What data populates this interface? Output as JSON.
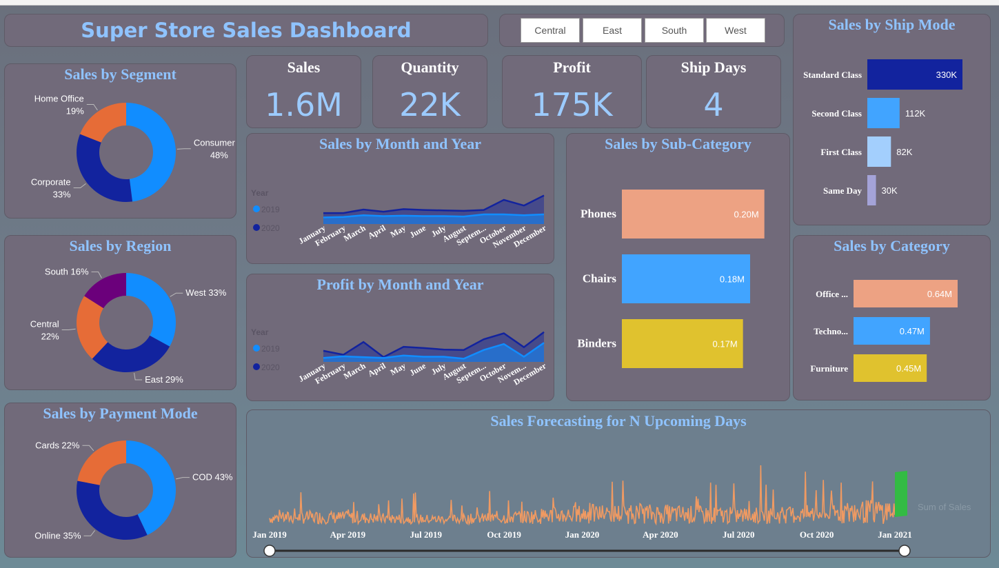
{
  "dashboard": {
    "title": "Super Store Sales Dashboard",
    "region_filters": [
      "Central",
      "East",
      "South",
      "West"
    ],
    "kpis": [
      {
        "label": "Sales",
        "value": "1.6M"
      },
      {
        "label": "Quantity",
        "value": "22K"
      },
      {
        "label": "Profit",
        "value": "175K"
      },
      {
        "label": "Ship Days",
        "value": "4"
      }
    ]
  },
  "colors": {
    "light_blue": "#118dff",
    "dark_blue": "#12239e",
    "orange": "#e66c37",
    "purple": "#6b007b",
    "salmon": "#eda283",
    "sky": "#41a4ff",
    "gold": "#e0c22e",
    "lavender": "#a4a3d8",
    "pale_blue": "#a3cffd",
    "forecast_line": "#f09a62",
    "forecast_band": "#33bb44"
  },
  "chart_data": [
    {
      "id": "segment",
      "type": "pie",
      "title": "Sales by Segment",
      "slices": [
        {
          "name": "Consumer",
          "value": 48,
          "label_line1": "Consumer",
          "label_line2": "48%",
          "color": "#118dff"
        },
        {
          "name": "Corporate",
          "value": 33,
          "label_line1": "Corporate",
          "label_line2": "33%",
          "color": "#12239e"
        },
        {
          "name": "Home Office",
          "value": 19,
          "label_line1": "Home Office",
          "label_line2": "19%",
          "color": "#e66c37"
        }
      ]
    },
    {
      "id": "region",
      "type": "pie",
      "title": "Sales by Region",
      "slices": [
        {
          "name": "West",
          "value": 33,
          "label_line1": "West 33%",
          "label_line2": "",
          "color": "#118dff"
        },
        {
          "name": "East",
          "value": 29,
          "label_line1": "East 29%",
          "label_line2": "",
          "color": "#12239e"
        },
        {
          "name": "Central",
          "value": 22,
          "label_line1": "Central",
          "label_line2": "22%",
          "color": "#e66c37"
        },
        {
          "name": "South",
          "value": 16,
          "label_line1": "South 16%",
          "label_line2": "",
          "color": "#6b007b"
        }
      ]
    },
    {
      "id": "payment",
      "type": "pie",
      "title": "Sales by Payment Mode",
      "slices": [
        {
          "name": "COD",
          "value": 43,
          "label_line1": "COD 43%",
          "label_line2": "",
          "color": "#118dff"
        },
        {
          "name": "Online",
          "value": 35,
          "label_line1": "Online 35%",
          "label_line2": "",
          "color": "#12239e"
        },
        {
          "name": "Cards",
          "value": 22,
          "label_line1": "Cards 22%",
          "label_line2": "",
          "color": "#e66c37"
        }
      ]
    },
    {
      "id": "sales_month",
      "type": "area",
      "title": "Sales by Month and Year",
      "legend_title": "Year",
      "categories": [
        "January",
        "February",
        "March",
        "April",
        "May",
        "June",
        "July",
        "August",
        "Septem...",
        "October",
        "November",
        "December"
      ],
      "series": [
        {
          "name": "2019",
          "values": [
            0.15,
            0.16,
            0.2,
            0.18,
            0.19,
            0.18,
            0.18,
            0.17,
            0.22,
            0.22,
            0.2,
            0.22
          ],
          "color": "#118dff"
        },
        {
          "name": "2020",
          "values": [
            0.25,
            0.25,
            0.33,
            0.28,
            0.34,
            0.32,
            0.31,
            0.3,
            0.32,
            0.55,
            0.42,
            0.65
          ],
          "color": "#12239e"
        }
      ],
      "ylim": [
        0,
        0.8
      ]
    },
    {
      "id": "profit_month",
      "type": "area",
      "title": "Profit by Month and Year",
      "legend_title": "Year",
      "categories": [
        "January",
        "February",
        "March",
        "April",
        "May",
        "June",
        "July",
        "August",
        "Septem...",
        "October",
        "Novem...",
        "December"
      ],
      "series": [
        {
          "name": "2019",
          "values": [
            0.1,
            0.14,
            0.12,
            0.1,
            0.16,
            0.13,
            0.13,
            0.08,
            0.3,
            0.45,
            0.13,
            0.48
          ],
          "color": "#118dff"
        },
        {
          "name": "2020",
          "values": [
            0.28,
            0.18,
            0.5,
            0.12,
            0.38,
            0.35,
            0.31,
            0.3,
            0.57,
            0.72,
            0.37,
            0.75
          ],
          "color": "#12239e"
        }
      ],
      "ylim": [
        0,
        0.85
      ]
    },
    {
      "id": "subcategory",
      "type": "bar",
      "title": "Sales by Sub-Category",
      "categories": [
        "Phones",
        "Chairs",
        "Binders"
      ],
      "values": [
        0.2,
        0.18,
        0.17
      ],
      "labels": [
        "0.20M",
        "0.18M",
        "0.17M"
      ],
      "colors": [
        "#eda283",
        "#41a4ff",
        "#e0c22e"
      ],
      "xlim": [
        0,
        0.21
      ]
    },
    {
      "id": "shipmode",
      "type": "bar",
      "title": "Sales by Ship Mode",
      "categories": [
        "Standard Class",
        "Second Class",
        "First Class",
        "Same Day"
      ],
      "values": [
        330,
        112,
        82,
        30
      ],
      "labels": [
        "330K",
        "112K",
        "82K",
        "30K"
      ],
      "colors": [
        "#12239e",
        "#41a4ff",
        "#a3cffd",
        "#a4a3d8"
      ],
      "xlim": [
        0,
        330
      ]
    },
    {
      "id": "category",
      "type": "bar",
      "title": "Sales by Category",
      "categories": [
        "Office ...",
        "Techno...",
        "Furniture"
      ],
      "values": [
        0.64,
        0.47,
        0.45
      ],
      "labels": [
        "0.64M",
        "0.47M",
        "0.45M"
      ],
      "colors": [
        "#eda283",
        "#41a4ff",
        "#e0c22e"
      ],
      "xlim": [
        0,
        0.64
      ]
    },
    {
      "id": "forecast",
      "type": "line",
      "title": "Sales Forecasting for N Upcoming Days",
      "x_ticks": [
        "Jan 2019",
        "Apr 2019",
        "Jul 2019",
        "Oct 2019",
        "Jan 2020",
        "Apr 2020",
        "Jul 2020",
        "Oct 2020",
        "Jan 2021"
      ],
      "legend": "Sum of Sales",
      "x_range": [
        "Jan 2019",
        "Jan 2021"
      ]
    }
  ]
}
